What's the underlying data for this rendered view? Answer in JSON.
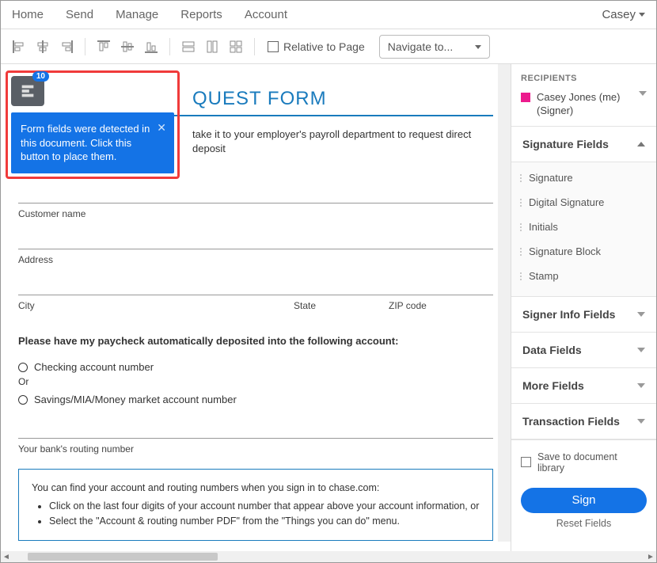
{
  "topnav": {
    "items": [
      "Home",
      "Send",
      "Manage",
      "Reports",
      "Account"
    ],
    "user": "Casey"
  },
  "toolbar": {
    "relative_label": "Relative to Page",
    "navigate_label": "Navigate to..."
  },
  "tooltip": {
    "badge": "10",
    "text": "Form fields were detected in this document. Click this button to place them."
  },
  "document": {
    "title_suffix": "QUEST FORM",
    "intro": "take it to your employer's payroll department to request direct deposit",
    "labels": {
      "customer": "Customer name",
      "address": "Address",
      "city": "City",
      "state": "State",
      "zip": "ZIP code"
    },
    "deposit_heading": "Please have my paycheck automatically deposited into the following account:",
    "checking": "Checking account number",
    "or": "Or",
    "savings": "Savings/MIA/Money market account number",
    "routing": "Your bank's routing number",
    "info_line": "You can find your account and routing numbers when you sign in to chase.com:",
    "info_b1": "Click on the last four digits of your account number that appear above your account information, or",
    "info_b2": "Select the \"Account & routing number PDF\" from the \"Things you can do\" menu."
  },
  "panel": {
    "recipients_header": "RECIPIENTS",
    "recipient_name": "Casey Jones (me) (Signer)",
    "sections": {
      "signature": "Signature Fields",
      "signer": "Signer Info Fields",
      "data": "Data Fields",
      "more": "More Fields",
      "transaction": "Transaction Fields"
    },
    "signature_items": [
      "Signature",
      "Digital Signature",
      "Initials",
      "Signature Block",
      "Stamp"
    ],
    "save_lib": "Save to document library",
    "sign": "Sign",
    "reset": "Reset Fields"
  }
}
